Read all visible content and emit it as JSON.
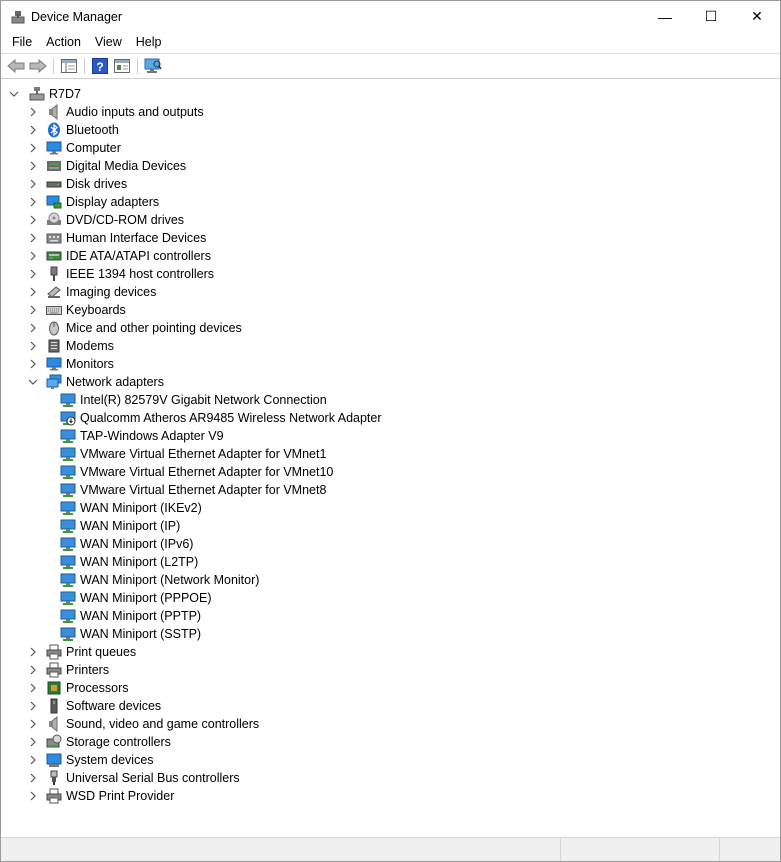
{
  "window": {
    "title": "Device Manager",
    "controls": {
      "minimize": "—",
      "maximize": "☐",
      "close": "✕"
    }
  },
  "menu": [
    "File",
    "Action",
    "View",
    "Help"
  ],
  "toolbar": [
    "back-icon",
    "forward-icon",
    "show-hide-tree-icon",
    "help-icon",
    "properties-icon",
    "scan-hardware-icon"
  ],
  "tree": {
    "root": {
      "label": "R7D7",
      "icon": "computer-icon",
      "expanded": true
    },
    "categories": [
      {
        "label": "Audio inputs and outputs",
        "icon": "speaker-icon"
      },
      {
        "label": "Bluetooth",
        "icon": "bluetooth-icon"
      },
      {
        "label": "Computer",
        "icon": "monitor-icon"
      },
      {
        "label": "Digital Media Devices",
        "icon": "media-device-icon"
      },
      {
        "label": "Disk drives",
        "icon": "disk-drive-icon"
      },
      {
        "label": "Display adapters",
        "icon": "display-adapter-icon"
      },
      {
        "label": "DVD/CD-ROM drives",
        "icon": "dvd-drive-icon"
      },
      {
        "label": "Human Interface Devices",
        "icon": "hid-icon"
      },
      {
        "label": "IDE ATA/ATAPI controllers",
        "icon": "ide-controller-icon"
      },
      {
        "label": "IEEE 1394 host controllers",
        "icon": "firewire-icon"
      },
      {
        "label": "Imaging devices",
        "icon": "camera-icon"
      },
      {
        "label": "Keyboards",
        "icon": "keyboard-icon"
      },
      {
        "label": "Mice and other pointing devices",
        "icon": "mouse-icon"
      },
      {
        "label": "Modems",
        "icon": "modem-icon"
      },
      {
        "label": "Monitors",
        "icon": "monitor-icon"
      },
      {
        "label": "Network adapters",
        "icon": "network-icon",
        "expanded": true,
        "children": [
          {
            "label": "Intel(R) 82579V Gigabit Network Connection",
            "icon": "network-adapter-icon"
          },
          {
            "label": "Qualcomm Atheros AR9485 Wireless Network Adapter",
            "icon": "network-adapter-disabled-icon"
          },
          {
            "label": "TAP-Windows Adapter V9",
            "icon": "network-adapter-icon"
          },
          {
            "label": "VMware Virtual Ethernet Adapter for VMnet1",
            "icon": "network-adapter-icon"
          },
          {
            "label": "VMware Virtual Ethernet Adapter for VMnet10",
            "icon": "network-adapter-icon"
          },
          {
            "label": "VMware Virtual Ethernet Adapter for VMnet8",
            "icon": "network-adapter-icon"
          },
          {
            "label": "WAN Miniport (IKEv2)",
            "icon": "network-adapter-icon"
          },
          {
            "label": "WAN Miniport (IP)",
            "icon": "network-adapter-icon"
          },
          {
            "label": "WAN Miniport (IPv6)",
            "icon": "network-adapter-icon"
          },
          {
            "label": "WAN Miniport (L2TP)",
            "icon": "network-adapter-icon"
          },
          {
            "label": "WAN Miniport (Network Monitor)",
            "icon": "network-adapter-icon"
          },
          {
            "label": "WAN Miniport (PPPOE)",
            "icon": "network-adapter-icon"
          },
          {
            "label": "WAN Miniport (PPTP)",
            "icon": "network-adapter-icon"
          },
          {
            "label": "WAN Miniport (SSTP)",
            "icon": "network-adapter-icon"
          }
        ]
      },
      {
        "label": "Print queues",
        "icon": "printer-icon"
      },
      {
        "label": "Printers",
        "icon": "printer-icon"
      },
      {
        "label": "Processors",
        "icon": "processor-icon"
      },
      {
        "label": "Software devices",
        "icon": "software-device-icon"
      },
      {
        "label": "Sound, video and game controllers",
        "icon": "speaker-icon"
      },
      {
        "label": "Storage controllers",
        "icon": "storage-controller-icon"
      },
      {
        "label": "System devices",
        "icon": "system-device-icon"
      },
      {
        "label": "Universal Serial Bus controllers",
        "icon": "usb-icon"
      },
      {
        "label": "WSD Print Provider",
        "icon": "printer-icon"
      }
    ]
  },
  "colors": {
    "network": "#3b8ed8",
    "monitor": "#2a8be0",
    "bluetooth": "#1f6fd6",
    "chip": "#2e7d32",
    "device": "#5a5a5a"
  }
}
